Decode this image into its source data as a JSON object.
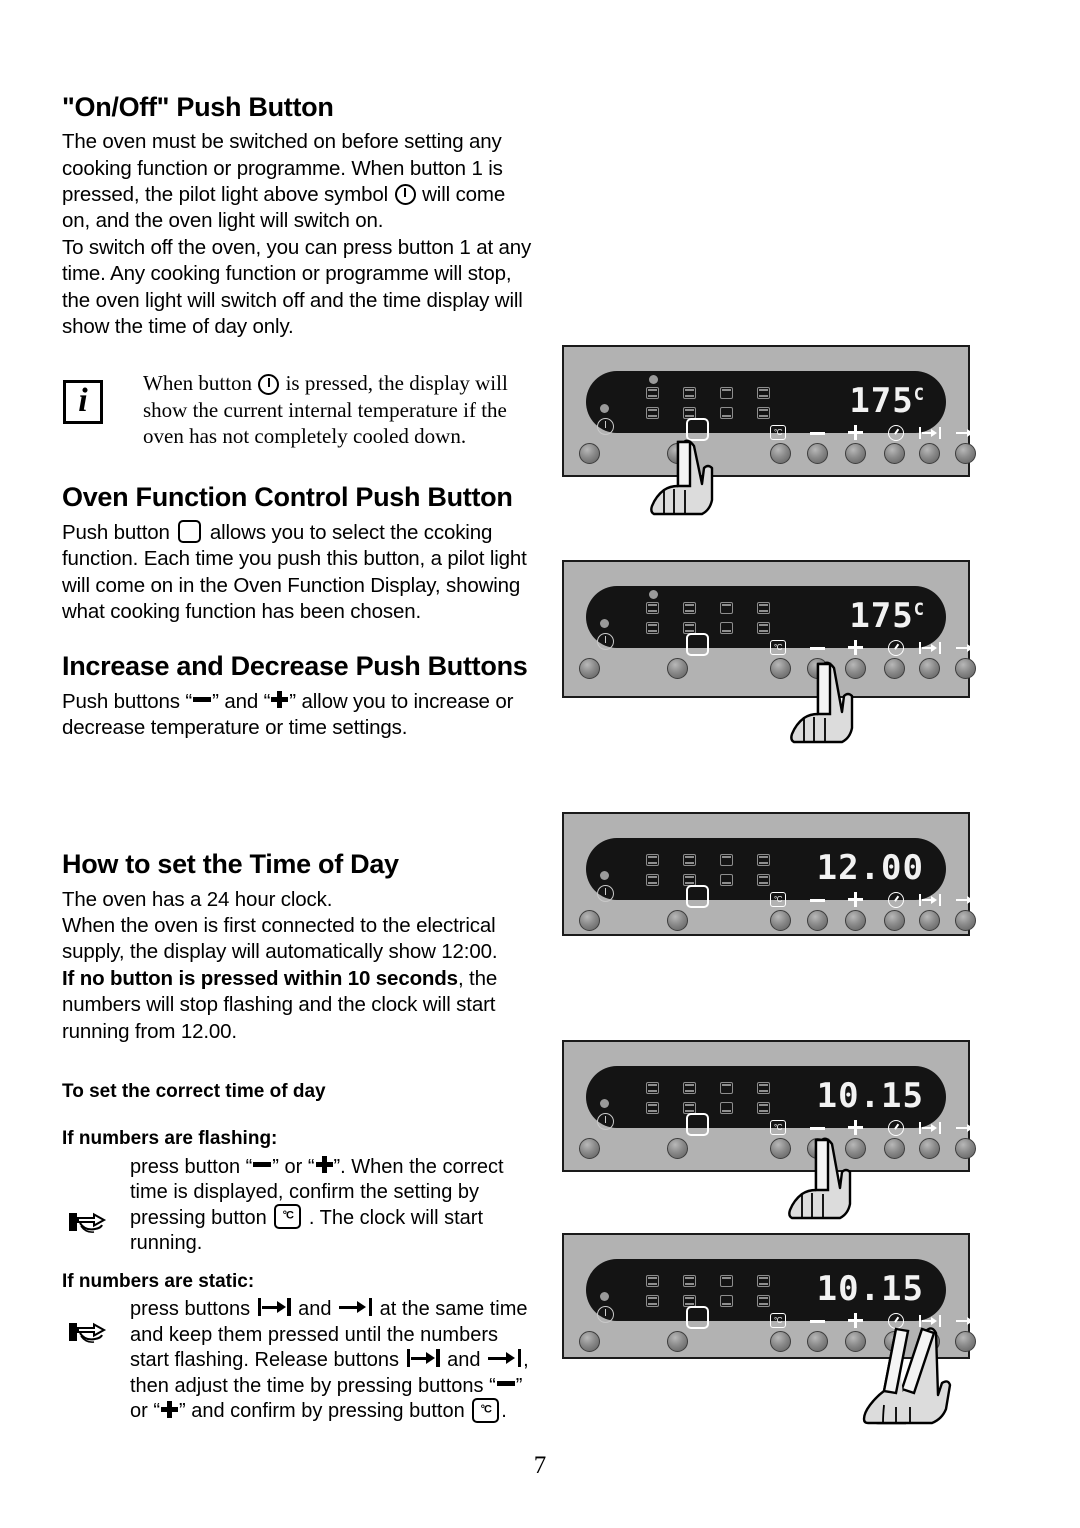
{
  "page_number": "7",
  "sections": [
    {
      "id": "on-off",
      "heading": "\"On/Off\" Push Button",
      "paragraphs": [
        "The oven must be switched on before setting any cooking function or programme. When button 1 is pressed, the pilot light above symbol ",
        " will come on, and the oven light will switch on.",
        "To switch off the oven, you can press button 1 at any time. Any cooking function or programme will stop, the oven light will switch off and the time display will show the time of day only."
      ]
    },
    {
      "id": "oven-function",
      "heading": "Oven Function Control Push Button",
      "paragraphs": [
        "Push button ",
        " allows you to select the ccoking function. Each time you push this button, a pilot light will come on in the Oven Function Display, showing what cooking function has been chosen."
      ]
    },
    {
      "id": "increase-decrease",
      "heading": "Increase and Decrease Push Buttons",
      "paragraphs": [
        "Push buttons “",
        "” and “",
        "” allow you to increase or decrease temperature or time settings."
      ]
    },
    {
      "id": "time-of-day",
      "heading": "How to set the Time of Day",
      "paragraphs": [
        "The oven has a 24 hour clock.",
        "When the oven is first connected to the electrical supply, the display will automatically show 12:00.",
        "If no button is pressed within 10 seconds",
        ", the numbers will stop flashing and the clock will start running from 12.00."
      ]
    }
  ],
  "note": {
    "icon_letter": "i",
    "text_before": "When button ",
    "text_after": " is pressed, the display will show the current internal temperature if the oven has not completely cooled down."
  },
  "procedure": {
    "title": "To set the correct time of day",
    "flashing": {
      "heading": "If numbers are flashing:",
      "t1": "press button “",
      "t2": "” or “",
      "t3": "”. When the correct time is displayed, confirm the setting by pressing button ",
      "t4": " . The clock will start running."
    },
    "static": {
      "heading": "If numbers are static:",
      "t1": "press buttons ",
      "t2": " and ",
      "t3": " at the same time and keep them pressed until the numbers start flashing. Release buttons ",
      "t4": " and ",
      "t5": ", then adjust the time by pressing buttons “",
      "t6": "” or “",
      "t7": "” and confirm by pressing button ",
      "t8": "."
    }
  },
  "panels": [
    {
      "id": "panel-function-press",
      "display_value": "175",
      "display_unit": "C",
      "pilot_top": true,
      "pilot_bottom": true,
      "hand": "function-button",
      "button_symbols": [
        "degC",
        "minus",
        "plus",
        "clock",
        "bar-arrow-bar",
        "arrow-bar"
      ]
    },
    {
      "id": "panel-minus-press",
      "display_value": "175",
      "display_unit": "C",
      "pilot_top": true,
      "pilot_bottom": true,
      "hand": "minus-button",
      "button_symbols": [
        "degC",
        "minus",
        "plus",
        "clock",
        "bar-arrow-bar",
        "arrow-bar"
      ]
    },
    {
      "id": "panel-clock-1200",
      "display_value": "12.00",
      "display_unit": "",
      "pilot_top": false,
      "pilot_bottom": true,
      "hand": "none",
      "button_symbols": [
        "degC",
        "minus",
        "plus",
        "clock",
        "bar-arrow-bar",
        "arrow-bar"
      ]
    },
    {
      "id": "panel-clock-1015-minus",
      "display_value": "10.15",
      "display_unit": "",
      "pilot_top": false,
      "pilot_bottom": true,
      "hand": "minus-button",
      "button_symbols": [
        "degC",
        "minus",
        "plus",
        "clock",
        "bar-arrow-bar",
        "arrow-bar"
      ]
    },
    {
      "id": "panel-clock-1015-arrows",
      "display_value": "10.15",
      "display_unit": "",
      "pilot_top": false,
      "pilot_bottom": true,
      "hand": "two-arrow-buttons",
      "button_symbols": [
        "degC",
        "minus",
        "plus",
        "clock",
        "bar-arrow-bar",
        "arrow-bar"
      ]
    }
  ],
  "colors": {
    "panel_bg": "#b2b2b2",
    "display_bg": "#141414",
    "segment": "#f2f2f2",
    "border": "#1a1a1a"
  }
}
